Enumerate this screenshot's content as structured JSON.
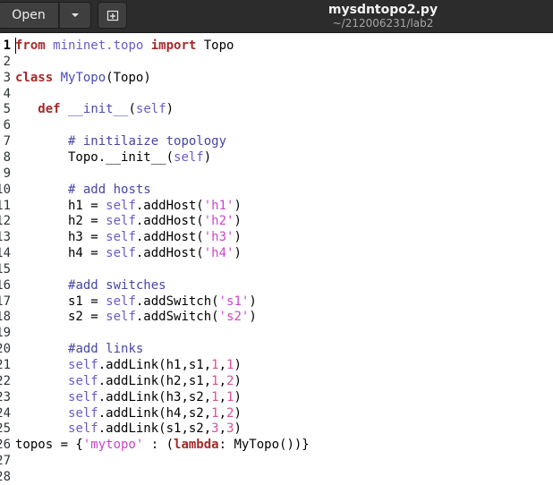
{
  "window": {
    "title": "mysdntopo2.py",
    "subtitle": "~/212006231/lab2"
  },
  "toolbar": {
    "open_label": "Open"
  },
  "editor": {
    "language": "python",
    "cursor_line": 1,
    "lines": [
      [
        {
          "t": "from",
          "c": "kw"
        },
        {
          "t": " "
        },
        {
          "t": "mininet.topo",
          "c": "mod"
        },
        {
          "t": " "
        },
        {
          "t": "import",
          "c": "kw"
        },
        {
          "t": " Topo"
        }
      ],
      [],
      [
        {
          "t": "class",
          "c": "kw"
        },
        {
          "t": " "
        },
        {
          "t": "MyTopo",
          "c": "fn"
        },
        {
          "t": "(Topo)"
        }
      ],
      [],
      [
        {
          "t": "   "
        },
        {
          "t": "def",
          "c": "kw"
        },
        {
          "t": " "
        },
        {
          "t": "__init__",
          "c": "fn"
        },
        {
          "t": "("
        },
        {
          "t": "self",
          "c": "slf"
        },
        {
          "t": ")"
        }
      ],
      [],
      [
        {
          "t": "       "
        },
        {
          "t": "# initilaize topology",
          "c": "cmt"
        }
      ],
      [
        {
          "t": "       Topo.__init__("
        },
        {
          "t": "self",
          "c": "slf"
        },
        {
          "t": ")"
        }
      ],
      [],
      [
        {
          "t": "       "
        },
        {
          "t": "# add hosts",
          "c": "cmt"
        }
      ],
      [
        {
          "t": "       h1 = "
        },
        {
          "t": "self",
          "c": "slf"
        },
        {
          "t": ".addHost("
        },
        {
          "t": "'h1'",
          "c": "str"
        },
        {
          "t": ")"
        }
      ],
      [
        {
          "t": "       h2 = "
        },
        {
          "t": "self",
          "c": "slf"
        },
        {
          "t": ".addHost("
        },
        {
          "t": "'h2'",
          "c": "str"
        },
        {
          "t": ")"
        }
      ],
      [
        {
          "t": "       h3 = "
        },
        {
          "t": "self",
          "c": "slf"
        },
        {
          "t": ".addHost("
        },
        {
          "t": "'h3'",
          "c": "str"
        },
        {
          "t": ")"
        }
      ],
      [
        {
          "t": "       h4 = "
        },
        {
          "t": "self",
          "c": "slf"
        },
        {
          "t": ".addHost("
        },
        {
          "t": "'h4'",
          "c": "str"
        },
        {
          "t": ")"
        }
      ],
      [],
      [
        {
          "t": "       "
        },
        {
          "t": "#add switches",
          "c": "cmt"
        }
      ],
      [
        {
          "t": "       s1 = "
        },
        {
          "t": "self",
          "c": "slf"
        },
        {
          "t": ".addSwitch("
        },
        {
          "t": "'s1'",
          "c": "str"
        },
        {
          "t": ")"
        }
      ],
      [
        {
          "t": "       s2 = "
        },
        {
          "t": "self",
          "c": "slf"
        },
        {
          "t": ".addSwitch("
        },
        {
          "t": "'s2'",
          "c": "str"
        },
        {
          "t": ")"
        }
      ],
      [],
      [
        {
          "t": "       "
        },
        {
          "t": "#add links",
          "c": "cmt"
        }
      ],
      [
        {
          "t": "       "
        },
        {
          "t": "self",
          "c": "slf"
        },
        {
          "t": ".addLink(h1,s1,"
        },
        {
          "t": "1",
          "c": "num"
        },
        {
          "t": ","
        },
        {
          "t": "1",
          "c": "num"
        },
        {
          "t": ")"
        }
      ],
      [
        {
          "t": "       "
        },
        {
          "t": "self",
          "c": "slf"
        },
        {
          "t": ".addLink(h2,s1,"
        },
        {
          "t": "1",
          "c": "num"
        },
        {
          "t": ","
        },
        {
          "t": "2",
          "c": "num"
        },
        {
          "t": ")"
        }
      ],
      [
        {
          "t": "       "
        },
        {
          "t": "self",
          "c": "slf"
        },
        {
          "t": ".addLink(h3,s2,"
        },
        {
          "t": "1",
          "c": "num"
        },
        {
          "t": ","
        },
        {
          "t": "1",
          "c": "num"
        },
        {
          "t": ")"
        }
      ],
      [
        {
          "t": "       "
        },
        {
          "t": "self",
          "c": "slf"
        },
        {
          "t": ".addLink(h4,s2,"
        },
        {
          "t": "1",
          "c": "num"
        },
        {
          "t": ","
        },
        {
          "t": "2",
          "c": "num"
        },
        {
          "t": ")"
        }
      ],
      [
        {
          "t": "       "
        },
        {
          "t": "self",
          "c": "slf"
        },
        {
          "t": ".addLink(s1,s2,"
        },
        {
          "t": "3",
          "c": "num"
        },
        {
          "t": ","
        },
        {
          "t": "3",
          "c": "num"
        },
        {
          "t": ")"
        }
      ],
      [
        {
          "t": "topos = {"
        },
        {
          "t": "'mytopo'",
          "c": "str"
        },
        {
          "t": " : ("
        },
        {
          "t": "lambda",
          "c": "kw"
        },
        {
          "t": ": MyTopo())}"
        }
      ],
      [],
      []
    ]
  }
}
